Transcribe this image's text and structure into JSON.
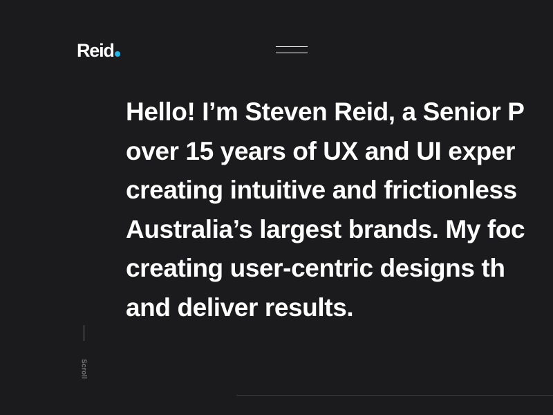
{
  "logo": {
    "text": "Reid",
    "dot_color": "#1fb6e8"
  },
  "menu": {
    "icon": "hamburger-menu-icon"
  },
  "intro": {
    "lines": [
      "Hello! I’m Steven Reid, a Senior P",
      "over 15 years of UX and UI exper",
      "creating intuitive and frictionless",
      "Australia’s largest brands. My foc",
      "creating user-centric designs th",
      "and deliver results."
    ]
  },
  "scroll": {
    "label": "Scroll"
  },
  "colors": {
    "background": "#1b1b1d",
    "text": "#ffffff",
    "accent": "#1fb6e8",
    "muted": "#7a7a7d"
  }
}
